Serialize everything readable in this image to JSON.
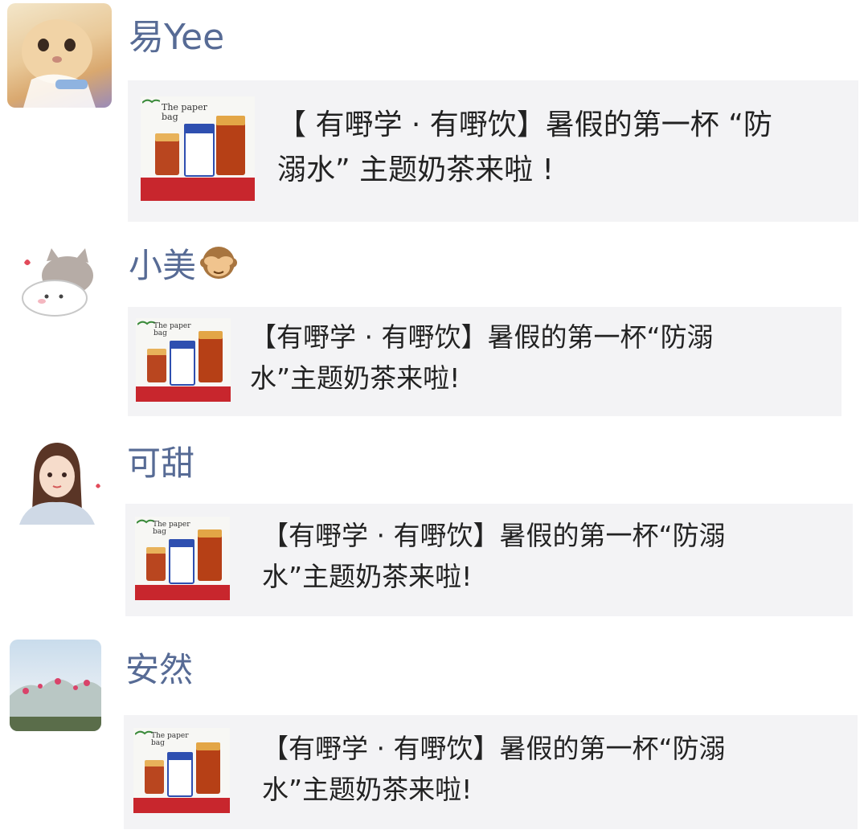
{
  "posts": [
    {
      "author": "易Yee",
      "avatar_icon": "cat-photo-avatar",
      "card_thumb_caption": "The paper bag",
      "card_title": "【有嘢学 · 有嘢饮】暑假的第一杯“防溺水”主题奶茶来啦!",
      "card_title_line1": "【 有嘢学 · 有嘢饮】暑假的第一杯 “防",
      "card_title_line2": "溺水” 主题奶茶来啦 !"
    },
    {
      "author": "小美",
      "author_emoji": "see-no-evil-monkey-icon",
      "avatar_icon": "cartoon-cats-avatar",
      "card_thumb_caption": "The paper bag",
      "card_title_line1": "【有嘢学 · 有嘢饮】暑假的第一杯“防溺",
      "card_title_line2": "水”主题奶茶来啦!"
    },
    {
      "author": "可甜",
      "avatar_icon": "cartoon-girl-avatar",
      "card_thumb_caption": "The paper bag",
      "card_title_line1": "【有嘢学 · 有嘢饮】暑假的第一杯“防溺",
      "card_title_line2": "水”主题奶茶来啦!"
    },
    {
      "author": "安然",
      "avatar_icon": "blossom-tree-avatar",
      "card_thumb_caption": "The paper bag",
      "card_title_line1": "【有嘢学 · 有嘢饮】暑假的第一杯“防溺",
      "card_title_line2": "水”主题奶茶来啦!"
    }
  ],
  "colors": {
    "name_blue": "#576b95",
    "card_bg": "#f3f3f5",
    "brand_red": "#c8262d"
  }
}
